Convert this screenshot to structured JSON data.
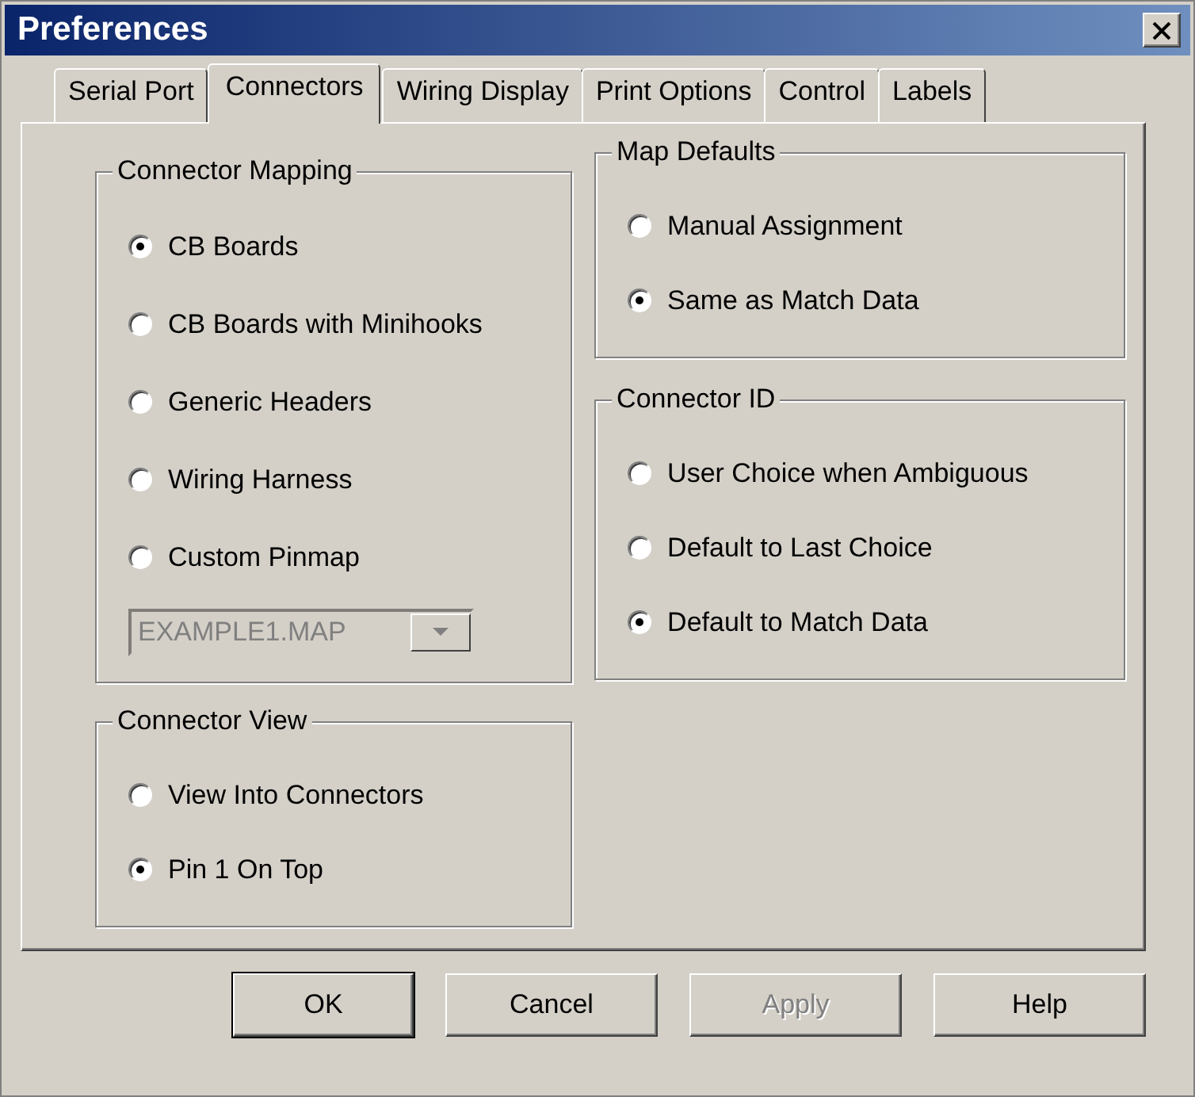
{
  "window": {
    "title": "Preferences"
  },
  "tabs": [
    {
      "label": "Serial Port",
      "selected": false
    },
    {
      "label": "Connectors",
      "selected": true
    },
    {
      "label": "Wiring Display",
      "selected": false
    },
    {
      "label": "Print Options",
      "selected": false
    },
    {
      "label": "Control",
      "selected": false
    },
    {
      "label": "Labels",
      "selected": false
    }
  ],
  "columns": [
    {
      "groups": [
        {
          "title": "Connector Mapping",
          "options": [
            {
              "label": "CB Boards",
              "selected": true
            },
            {
              "label": "CB Boards with Minihooks",
              "selected": false
            },
            {
              "label": "Generic Headers",
              "selected": false
            },
            {
              "label": "Wiring Harness",
              "selected": false
            },
            {
              "label": "Custom Pinmap",
              "selected": false
            }
          ],
          "dropdown": {
            "value": "EXAMPLE1.MAP",
            "disabled": true
          }
        },
        {
          "title": "Connector View",
          "options": [
            {
              "label": "View Into Connectors",
              "selected": false
            },
            {
              "label": "Pin 1 On Top",
              "selected": true
            }
          ]
        }
      ]
    },
    {
      "groups": [
        {
          "title": "Map Defaults",
          "options": [
            {
              "label": "Manual Assignment",
              "selected": false
            },
            {
              "label": "Same as Match Data",
              "selected": true
            }
          ]
        },
        {
          "title": "Connector ID",
          "options": [
            {
              "label": "User Choice when Ambiguous",
              "selected": false
            },
            {
              "label": "Default to Last Choice",
              "selected": false
            },
            {
              "label": "Default to Match Data",
              "selected": true
            }
          ]
        }
      ]
    }
  ],
  "buttons": [
    {
      "label": "OK",
      "default": true,
      "disabled": false
    },
    {
      "label": "Cancel",
      "default": false,
      "disabled": false
    },
    {
      "label": "Apply",
      "default": false,
      "disabled": true
    },
    {
      "label": "Help",
      "default": false,
      "disabled": false
    }
  ]
}
